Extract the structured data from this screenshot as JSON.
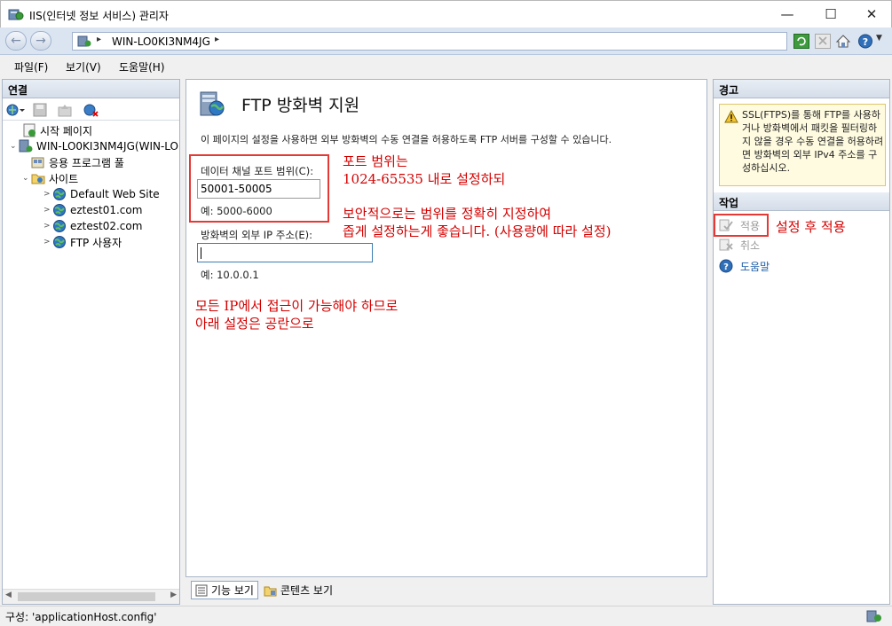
{
  "window": {
    "title": "IIS(인터넷 정보 서비스) 관리자",
    "minimize_glyph": "—",
    "maximize_glyph": "☐",
    "close_glyph": "✕"
  },
  "address": {
    "back_glyph": "←",
    "forward_glyph": "→",
    "path": "WIN-LO0KI3NM4JG",
    "sep1": "▸",
    "sep2": "▸"
  },
  "menu": {
    "items": [
      "파일(F)",
      "보기(V)",
      "도움말(H)"
    ]
  },
  "connections": {
    "header": "연결",
    "tree": [
      {
        "label": "시작 페이지",
        "icon": "start-page-icon"
      },
      {
        "label": "WIN-LO0KI3NM4JG(WIN-LO",
        "icon": "server-icon",
        "expander": "⌄"
      },
      {
        "label": "응용 프로그램 풀",
        "icon": "app-pool-icon"
      },
      {
        "label": "사이트",
        "icon": "sites-folder-icon",
        "expander": "⌄"
      },
      {
        "label": "Default Web Site",
        "icon": "globe-icon",
        "expander": ">"
      },
      {
        "label": "eztest01.com",
        "icon": "globe-icon",
        "expander": ">"
      },
      {
        "label": "eztest02.com",
        "icon": "globe-icon",
        "expander": ">"
      },
      {
        "label": "FTP 사용자",
        "icon": "globe-icon",
        "expander": ">"
      }
    ]
  },
  "center": {
    "title": "FTP 방화벽 지원",
    "description": "이 페이지의 설정을 사용하면 외부 방화벽의 수동 연결을 허용하도록 FTP 서버를 구성할 수 있습니다.",
    "port_range_label": "데이터 채널 포트 범위(C):",
    "port_range_value": "50001-50005",
    "port_range_example": "예: 5000-6000",
    "external_ip_label": "방화벽의 외부 IP 주소(E):",
    "external_ip_value": "",
    "external_ip_example": "예: 10.0.0.1"
  },
  "annotations": {
    "port_note_1": "포트 범위는",
    "port_note_2": "1024-65535 내로 설정하되",
    "security_note_1": "보안적으로는 범위를 정확히 지정하여",
    "security_note_2": "좁게 설정하는게 좋습니다. (사용량에 따라 설정)",
    "ip_note_1": "모든 IP에서 접근이 가능해야 하므로",
    "ip_note_2": "아래 설정은 공란으로",
    "apply_note": "설정 후 적용",
    "color": "#d40000"
  },
  "bottom_tabs": {
    "features_view": "기능 보기",
    "content_view": "콘텐츠 보기"
  },
  "right": {
    "alerts_header": "경고",
    "alert_text": "SSL(FTPS)를 통해 FTP를 사용하거나 방화벽에서 패킷을 필터링하지 않을 경우 수동 연결을 허용하려면 방화벽의 외부 IPv4 주소를 구성하십시오.",
    "actions_header": "작업",
    "apply": "적용",
    "cancel": "취소",
    "help": "도움말"
  },
  "status": {
    "text": "구성: 'applicationHost.config'"
  }
}
